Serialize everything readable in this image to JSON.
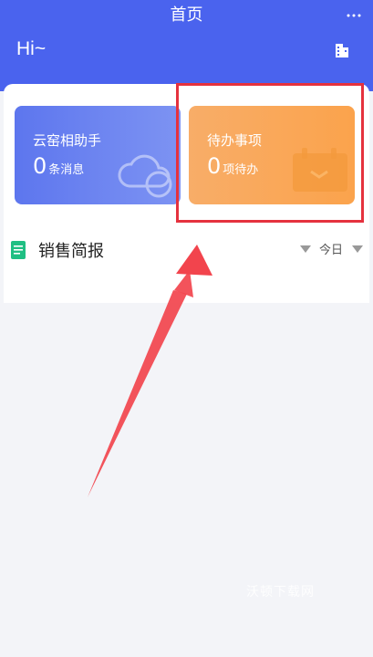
{
  "nav": {
    "title": "首页",
    "more_icon": "more-dots-icon"
  },
  "header": {
    "greeting": "Hi~",
    "building_icon": "building-icon"
  },
  "cards": {
    "assistant": {
      "title": "云窑相助手",
      "count": "0",
      "unit": "条消息",
      "icon": "cloud-icon"
    },
    "todo": {
      "title": "待办事项",
      "count": "0",
      "unit": "项待办",
      "icon": "folder-icon"
    }
  },
  "sales_report": {
    "title": "销售简报",
    "period": "今日"
  },
  "watermark": "沃顿下载网",
  "colors": {
    "primary": "#4a63ee",
    "todo": "#fba34c",
    "highlight": "#e5323e",
    "doc_icon": "#1fbf83"
  }
}
